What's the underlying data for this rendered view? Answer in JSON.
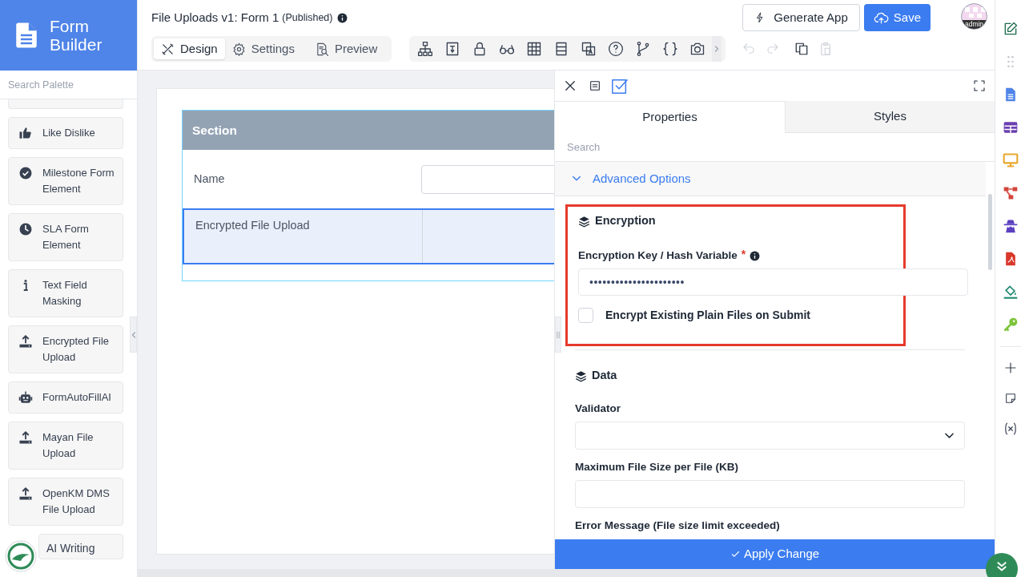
{
  "logo": {
    "title": "Form Builder"
  },
  "header": {
    "title": "File Uploads v1: Form 1",
    "status": "(Published)"
  },
  "mode_tabs": [
    {
      "label": "Design",
      "kind": "design",
      "selected": true
    },
    {
      "label": "Settings",
      "kind": "settings",
      "selected": false
    },
    {
      "label": "Preview",
      "kind": "preview",
      "selected": false
    }
  ],
  "actions": [
    {
      "label": "Generate App",
      "kind": "secondary"
    },
    {
      "label": "Save",
      "kind": "primary"
    }
  ],
  "user": {
    "label": "admin"
  },
  "palette": {
    "placeholder": "Search Palette",
    "items": [
      {
        "label": "Like Dislike",
        "kind": "thumb"
      },
      {
        "label": "Milestone Form Element",
        "kind": "check"
      },
      {
        "label": "SLA Form Element",
        "kind": "clock"
      },
      {
        "label": "Text Field Masking",
        "kind": "info"
      },
      {
        "label": "Encrypted File Upload",
        "kind": "upload"
      },
      {
        "label": "FormAutoFillAI",
        "kind": "robot"
      },
      {
        "label": "Mayan File Upload",
        "kind": "upload"
      },
      {
        "label": "OpenKM DMS File Upload",
        "kind": "upload"
      },
      {
        "label": "AI Writing",
        "kind": "ai"
      }
    ]
  },
  "canvas": {
    "section_title": "Section",
    "rows": [
      {
        "label": "Name",
        "selected": false
      },
      {
        "label": "Encrypted File Upload",
        "selected": true
      }
    ]
  },
  "panel": {
    "tabs": [
      {
        "label": "Properties",
        "selected": true
      },
      {
        "label": "Styles",
        "selected": false
      }
    ],
    "search_placeholder": "Search",
    "group": {
      "label": "Advanced Options",
      "expanded": true
    },
    "encryption": {
      "title": "Encryption",
      "highlighted": true,
      "key_label": "Encryption Key / Hash Variable",
      "required_mark": "*",
      "key_value": "••••••••••••••••••••••",
      "checkbox": {
        "label": "Encrypt Existing Plain Files on Submit",
        "checked": false
      }
    },
    "data": {
      "title": "Data",
      "fields": [
        {
          "label": "Validator",
          "kind": "select"
        },
        {
          "label": "Maximum File Size per File (KB)",
          "kind": "text"
        },
        {
          "label": "Error Message (File size limit exceeded)"
        }
      ]
    },
    "apply_label": "Apply Change"
  }
}
